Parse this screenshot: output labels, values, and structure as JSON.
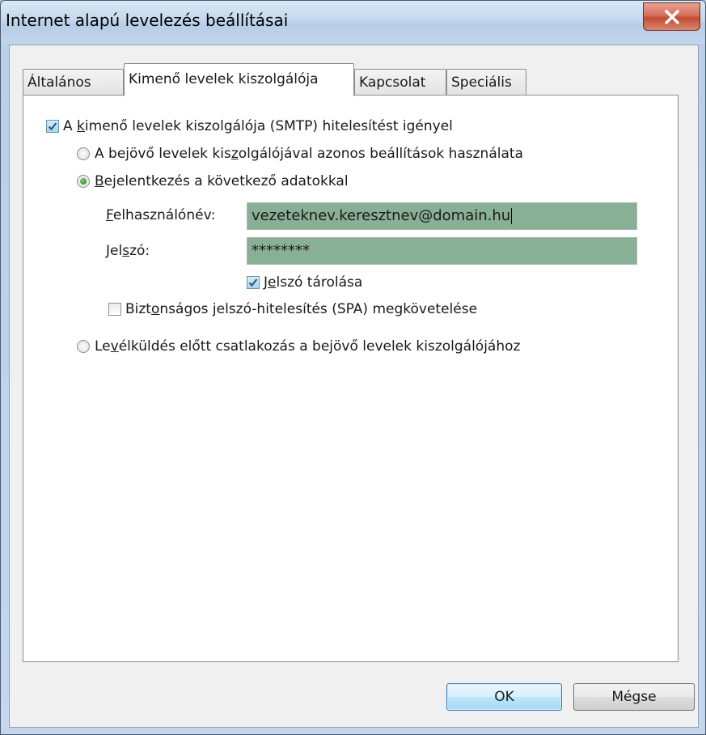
{
  "window": {
    "title": "Internet alapú levelezés beállításai"
  },
  "tabs": [
    {
      "label": "Általános",
      "active": false
    },
    {
      "label": "Kimenő levelek kiszolgálója",
      "active": true
    },
    {
      "label": "Kapcsolat",
      "active": false
    },
    {
      "label": "Speciális",
      "active": false
    }
  ],
  "smtp_auth": {
    "checked": true,
    "label_before": "A ",
    "label_accel": "k",
    "label_after": "imenő levelek kiszolgálója (SMTP) hitelesítést igényel"
  },
  "options": {
    "same_settings": {
      "selected": false,
      "label_before": "A bejövő levelek kis",
      "label_accel": "z",
      "label_after": "olgálójával azonos beállítások használata"
    },
    "login_with": {
      "selected": true,
      "label_before": "",
      "label_accel": "B",
      "label_after": "ejelentkezés a következő adatokkal"
    },
    "login_before_send": {
      "selected": false,
      "label_before": "Le",
      "label_accel": "v",
      "label_after": "élküldés előtt csatlakozás a bejövő levelek kiszolgálójához"
    }
  },
  "fields": {
    "username_label_accel": "F",
    "username_label_rest": "elhasználónév:",
    "username_value": "vezeteknev.keresztnev@domain.hu",
    "password_label_before": "Jel",
    "password_label_accel": "s",
    "password_label_after": "zó:",
    "password_value": "********"
  },
  "remember_password": {
    "checked": true,
    "label_before": "J",
    "label_accel": "e",
    "label_after": "lszó tárolása"
  },
  "spa": {
    "checked": false,
    "label_before": "Bizt",
    "label_accel": "o",
    "label_after": "nságos jelszó-hitelesítés (SPA) megkövetelése"
  },
  "buttons": {
    "ok": "OK",
    "cancel": "Mégse"
  },
  "colors": {
    "field_fill": "#88b096",
    "close_button": "#c24a33"
  }
}
